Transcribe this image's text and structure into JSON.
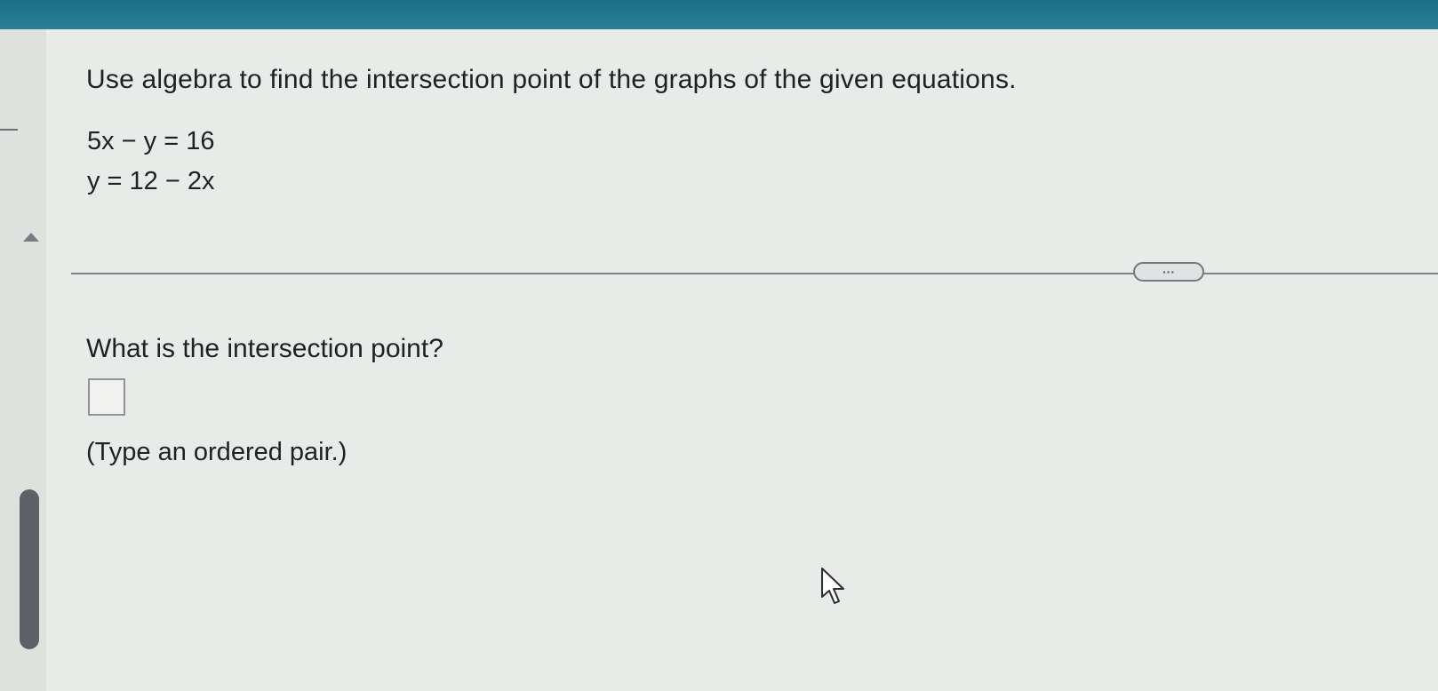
{
  "header": {
    "color": "#1c6e86"
  },
  "question": {
    "instruction": "Use algebra to find the intersection point of the graphs of the given equations.",
    "equations": [
      "5x − y = 16",
      "y = 12 − 2x"
    ]
  },
  "toolbar": {
    "more_label": "···"
  },
  "answer": {
    "prompt": "What is the intersection point?",
    "value": "",
    "hint": "(Type an ordered pair.)"
  },
  "icons": {
    "collapse": "triangle-up-icon",
    "cursor": "mouse-pointer-icon"
  }
}
